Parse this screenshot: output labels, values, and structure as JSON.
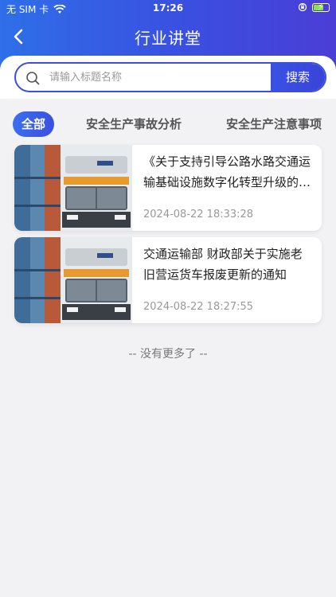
{
  "status_bar": {
    "carrier": "无 SIM 卡",
    "time": "17:26"
  },
  "nav": {
    "title": "行业讲堂"
  },
  "search": {
    "placeholder": "请输入标题名称",
    "value": "",
    "button_label": "搜索"
  },
  "tabs": [
    {
      "label": "全部",
      "active": true
    },
    {
      "label": "安全生产事故分析",
      "active": false
    },
    {
      "label": "安全生产注意事项",
      "active": false
    }
  ],
  "articles": [
    {
      "title": "《关于支持引导公路水路交通运输基础设施数字化转型升级的通知》",
      "date": "2024-08-22 18:33:28",
      "thumbnail_icon": "truck-image"
    },
    {
      "title": "交通运输部 财政部关于实施老旧营运货车报废更新的通知",
      "date": "2024-08-22 18:27:55",
      "thumbnail_icon": "truck-image"
    }
  ],
  "footer": {
    "no_more_text": "--  没有更多了  --"
  },
  "colors": {
    "accent": "#3a4fe0",
    "header_gradient_start": "#2f6fe8",
    "header_gradient_end": "#4a3ed6",
    "date_gray": "#999999"
  }
}
